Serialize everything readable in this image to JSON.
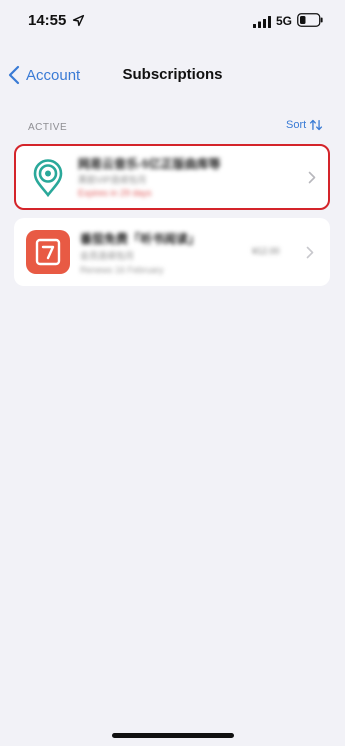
{
  "status_bar": {
    "time": "14:55",
    "network": "5G",
    "icons": [
      "location-arrow-icon",
      "signal-icon",
      "battery-icon"
    ]
  },
  "nav": {
    "back_label": "Account",
    "title": "Subscriptions"
  },
  "section": {
    "header": "ACTIVE",
    "sort_label": "Sort"
  },
  "subscriptions": [
    {
      "title": "网易云音乐-5亿正版曲库等",
      "subtitle": "黑胶VIP连续包月",
      "status": "Expires in 29 days",
      "icon": "location-pin-icon",
      "highlighted": true
    },
    {
      "title": "番茄免费「听书阅读」",
      "subtitle": "会员连续包月",
      "status": "Renews 16 February",
      "price": "¥12.00",
      "icon": "book-app-icon",
      "highlighted": false
    }
  ],
  "colors": {
    "accent": "#3a7bd5",
    "highlight_border": "#d4242a",
    "background": "#f2f2f7",
    "expiry_text": "#e05a5a",
    "app_teal": "#2aa89a",
    "app_red": "#e85a44"
  }
}
